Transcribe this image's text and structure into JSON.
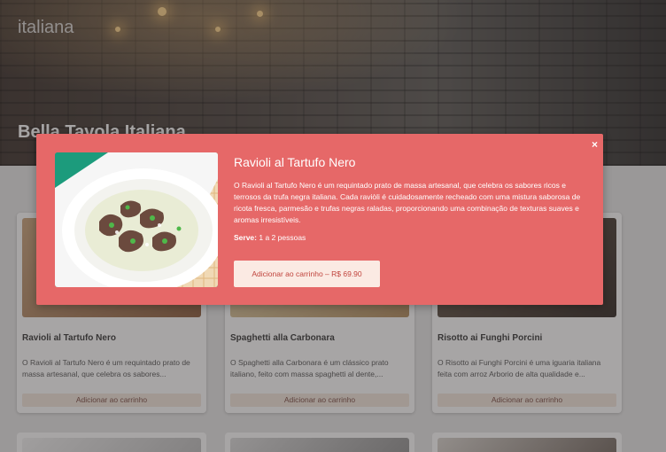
{
  "header": {
    "brand": "italiana",
    "title": "Bella Tavola Italiana"
  },
  "menu": {
    "items": [
      {
        "name": "Ravioli al Tartufo Nero",
        "description": "O Ravioli al Tartufo Nero é um requintado prato de massa artesanal, que celebra os sabores...",
        "button": "Adicionar ao carrinho"
      },
      {
        "name": "Spaghetti alla Carbonara",
        "description": "O Spaghetti alla Carbonara é um clássico prato italiano, feito com massa spaghetti al dente,...",
        "button": "Adicionar ao carrinho"
      },
      {
        "name": "Risotto ai Funghi Porcini",
        "description": "O Risotto ai Funghi Porcini é uma iguaria italiana feita com arroz Arborio de alta qualidade e...",
        "button": "Adicionar ao carrinho"
      }
    ]
  },
  "modal": {
    "close_label": "×",
    "title": "Ravioli al Tartufo Nero",
    "description": "O Ravioli al Tartufo Nero é um requintado prato de massa artesanal, que celebra os sabores ricos e terrosos da trufa negra italiana. Cada raviòli é cuidadosamente recheado com uma mistura saborosa de ricota fresca, parmesão e trufas negras raladas, proporcionando uma combinação de texturas suaves e aromas irresistíveis.",
    "serve_label": "Serve:",
    "serve_value": "1 a 2 pessoas",
    "add_button": "Adicionar ao carrinho – R$ 69.90"
  },
  "colors": {
    "modal_bg": "#e66868",
    "button_bg": "#fbeae3",
    "button_text": "#c0443d"
  }
}
